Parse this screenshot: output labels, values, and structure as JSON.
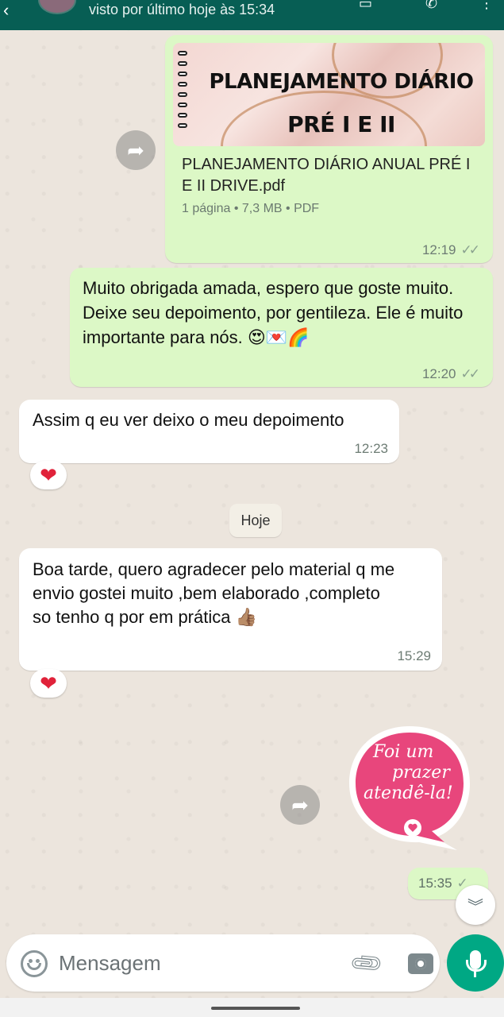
{
  "header": {
    "status": "visto por último hoje às 15:34"
  },
  "messages": {
    "doc": {
      "preview_line1": "PLANEJAMENTO DIÁRIO",
      "preview_line2": "PRÉ I E II",
      "filename": "PLANEJAMENTO DIÁRIO ANUAL PRÉ I E II DRIVE.pdf",
      "meta": "1 página • 7,3 MB • PDF",
      "time": "12:19"
    },
    "out1": {
      "text": "Muito obrigada amada, espero que goste muito. Deixe seu depoimento, por gentileza. Ele é muito importante para nós. 😍💌🌈",
      "time": "12:20"
    },
    "in1": {
      "text": "Assim q eu ver deixo o meu depoimento",
      "time": "12:23",
      "reaction": "❤"
    },
    "date_chip": "Hoje",
    "in2": {
      "text": "Boa tarde, quero agradecer pelo material q me envio gostei muito ,bem elaborado ,completo so  tenho q  por em prática 👍🏽",
      "time": "15:29",
      "reaction": "❤"
    },
    "sticker": {
      "line1": "Foi um",
      "line2": "prazer",
      "line3": "atendê-la!",
      "time": "15:35"
    }
  },
  "input": {
    "placeholder": "Mensagem"
  },
  "colors": {
    "outgoing_bubble": "#dcf8c6",
    "incoming_bubble": "#ffffff",
    "accent": "#00a884",
    "header": "#075e54",
    "sticker_pink": "#e8467c"
  },
  "icons": {
    "forward": "forward-icon",
    "ticks": "double-check-icon",
    "emoji": "emoji-icon",
    "attach": "paperclip-icon",
    "camera": "camera-icon",
    "mic": "mic-icon",
    "scroll": "chevrons-down-icon"
  }
}
